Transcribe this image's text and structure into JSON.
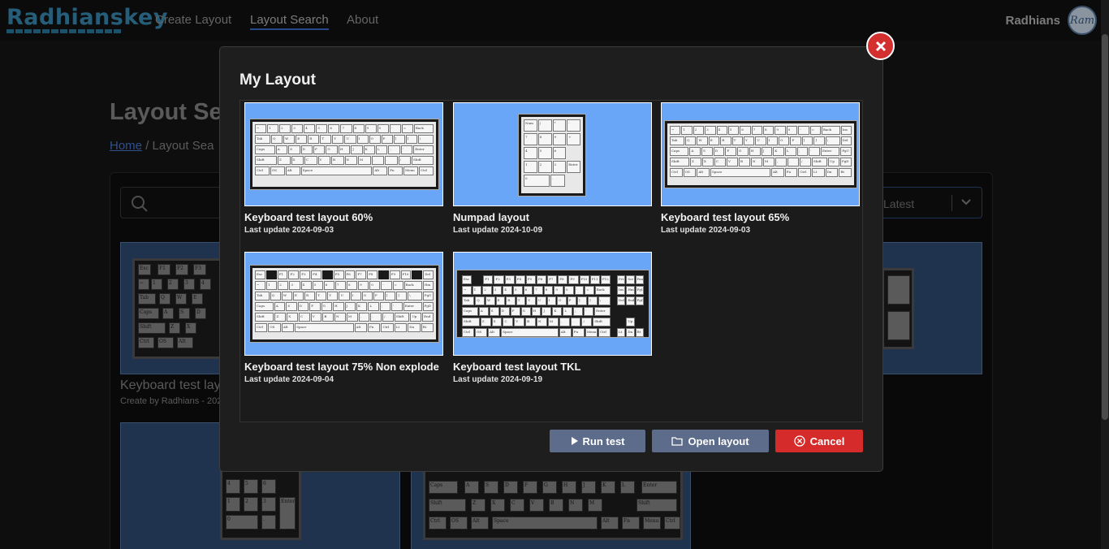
{
  "navbar": {
    "brand": "Radhianskey",
    "links": [
      "Create Layout",
      "Layout Search",
      "About"
    ],
    "active_link": "Layout Search",
    "user_name": "Radhians",
    "avatar_text": "Ram"
  },
  "page": {
    "title": "Layout Sea",
    "breadcrumb_home": "Home",
    "breadcrumb_current": "/ Layout Sea",
    "sort_label": "Latest",
    "bg_card_title": "Keyboard test lay",
    "bg_card_sub": "Create by Radhians - 202"
  },
  "modal": {
    "title": "My Layout",
    "layouts": [
      {
        "name": "Keyboard test layout 60%",
        "date": "Last update 2024-09-03",
        "thumb": "keyboard-60"
      },
      {
        "name": "Numpad layout",
        "date": "Last update 2024-10-09",
        "thumb": "numpad"
      },
      {
        "name": "Keyboard test layout 65%",
        "date": "Last update 2024-09-03",
        "thumb": "keyboard-65"
      },
      {
        "name": "Keyboard test layout 75% Non explode",
        "date": "Last update 2024-09-04",
        "thumb": "keyboard-75"
      },
      {
        "name": "Keyboard test layout TKL",
        "date": "Last update 2024-09-19",
        "thumb": "keyboard-tkl"
      }
    ],
    "buttons": {
      "run_test": "Run test",
      "open_layout": "Open layout",
      "cancel": "Cancel"
    }
  },
  "colors": {
    "accent": "#3b8fb8",
    "thumb_bg": "#6aa6f8",
    "cancel": "#d62b2b",
    "secondary_button": "#5c6c8a",
    "close": "#d32f2f"
  },
  "icons": [
    "search-icon",
    "chevron-down-icon",
    "close-icon",
    "play-icon",
    "folder-icon",
    "cancel-circle-icon"
  ]
}
